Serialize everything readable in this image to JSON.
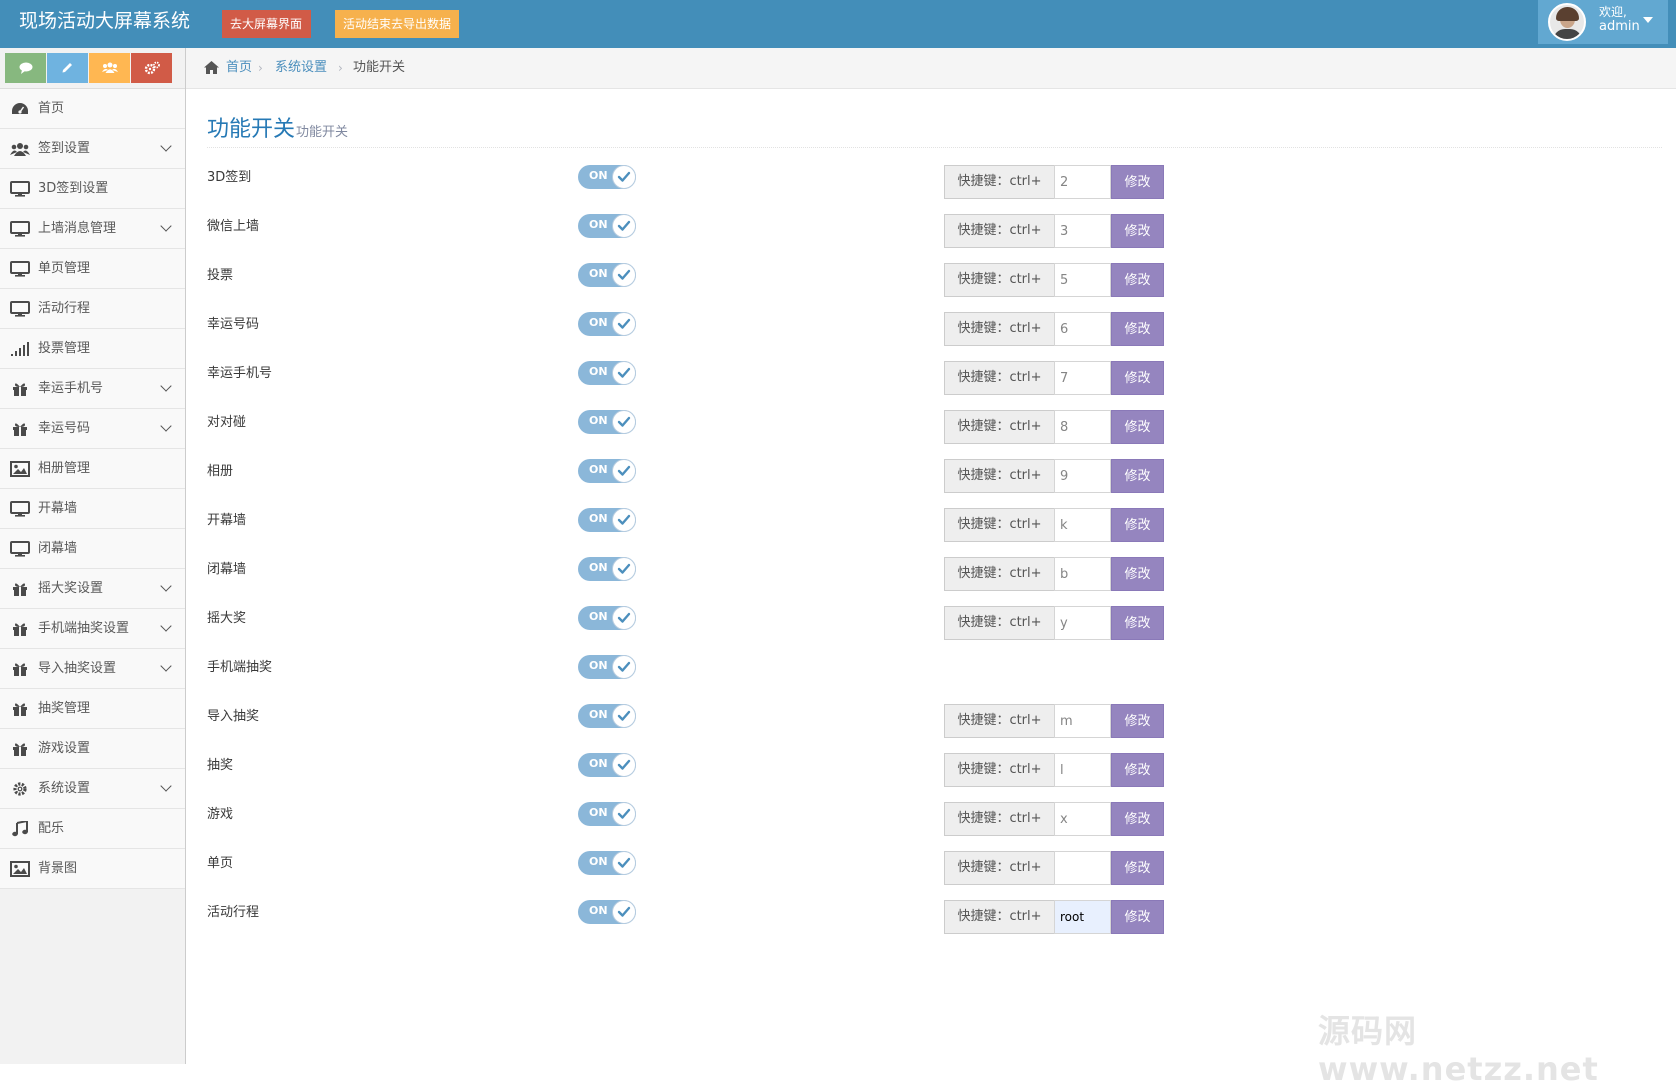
{
  "app": {
    "title": "现场活动大屏幕系统",
    "btn_screen": "去大屏幕界面",
    "btn_export": "活动结束去导出数据",
    "welcome": "欢迎,",
    "username": "admin"
  },
  "sidebar": {
    "items": [
      {
        "label": "首页",
        "icon": "dashboard-icon",
        "arrow": false
      },
      {
        "label": "签到设置",
        "icon": "users-icon",
        "arrow": true
      },
      {
        "label": "3D签到设置",
        "icon": "desktop-icon",
        "arrow": false
      },
      {
        "label": "上墙消息管理",
        "icon": "desktop-icon",
        "arrow": true
      },
      {
        "label": "单页管理",
        "icon": "desktop-icon",
        "arrow": false
      },
      {
        "label": "活动行程",
        "icon": "desktop-icon",
        "arrow": false
      },
      {
        "label": "投票管理",
        "icon": "signal-icon",
        "arrow": false
      },
      {
        "label": "幸运手机号",
        "icon": "gift-icon",
        "arrow": true
      },
      {
        "label": "幸运号码",
        "icon": "gift-icon",
        "arrow": true
      },
      {
        "label": "相册管理",
        "icon": "picture-icon",
        "arrow": false
      },
      {
        "label": "开幕墙",
        "icon": "desktop-icon",
        "arrow": false
      },
      {
        "label": "闭幕墙",
        "icon": "desktop-icon",
        "arrow": false
      },
      {
        "label": "摇大奖设置",
        "icon": "gift-icon",
        "arrow": true
      },
      {
        "label": "手机端抽奖设置",
        "icon": "gift-icon",
        "arrow": true
      },
      {
        "label": "导入抽奖设置",
        "icon": "gift-icon",
        "arrow": true
      },
      {
        "label": "抽奖管理",
        "icon": "gift-icon",
        "arrow": false
      },
      {
        "label": "游戏设置",
        "icon": "gift-icon",
        "arrow": false
      },
      {
        "label": "系统设置",
        "icon": "cog-icon",
        "arrow": true
      },
      {
        "label": "配乐",
        "icon": "music-icon",
        "arrow": false
      },
      {
        "label": "背景图",
        "icon": "picture-icon",
        "arrow": false
      }
    ]
  },
  "breadcrumb": {
    "home": "首页",
    "settings": "系统设置",
    "current": "功能开关"
  },
  "header": {
    "title": "功能开关",
    "subtitle": "功能开关"
  },
  "switch_on_label": "ON",
  "hotkey_prefix": "快捷键：ctrl+",
  "modify_label": "修改",
  "features": [
    {
      "label": "3D签到",
      "on": true,
      "hotkey": "2",
      "has_hotkey": true
    },
    {
      "label": "微信上墙",
      "on": true,
      "hotkey": "3",
      "has_hotkey": true
    },
    {
      "label": "投票",
      "on": true,
      "hotkey": "5",
      "has_hotkey": true
    },
    {
      "label": "幸运号码",
      "on": true,
      "hotkey": "6",
      "has_hotkey": true
    },
    {
      "label": "幸运手机号",
      "on": true,
      "hotkey": "7",
      "has_hotkey": true
    },
    {
      "label": "对对碰",
      "on": true,
      "hotkey": "8",
      "has_hotkey": true
    },
    {
      "label": "相册",
      "on": true,
      "hotkey": "9",
      "has_hotkey": true
    },
    {
      "label": "开幕墙",
      "on": true,
      "hotkey": "k",
      "has_hotkey": true
    },
    {
      "label": "闭幕墙",
      "on": true,
      "hotkey": "b",
      "has_hotkey": true
    },
    {
      "label": "摇大奖",
      "on": true,
      "hotkey": "y",
      "has_hotkey": true
    },
    {
      "label": "手机端抽奖",
      "on": true,
      "hotkey": "",
      "has_hotkey": false
    },
    {
      "label": "导入抽奖",
      "on": true,
      "hotkey": "m",
      "has_hotkey": true
    },
    {
      "label": "抽奖",
      "on": true,
      "hotkey": "l",
      "has_hotkey": true
    },
    {
      "label": "游戏",
      "on": true,
      "hotkey": "x",
      "has_hotkey": true
    },
    {
      "label": "单页",
      "on": true,
      "hotkey": "",
      "has_hotkey": true
    },
    {
      "label": "活动行程",
      "on": true,
      "hotkey": "root",
      "has_hotkey": true
    }
  ],
  "watermark": "源码网www.netzz.net",
  "colors": {
    "navbar": "#438eb9",
    "accent_title": "#2679b5",
    "modify_button": "#9585bf",
    "toggle_on": "#8bb7d9"
  }
}
